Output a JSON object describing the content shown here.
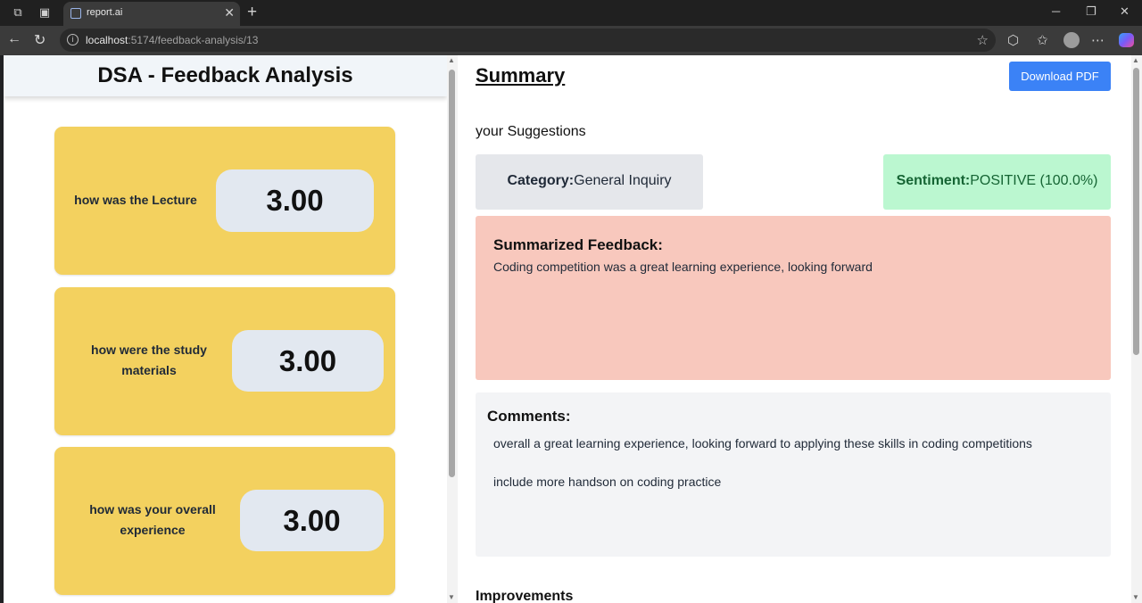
{
  "browser": {
    "tab_title": "report.ai",
    "url_host": "localhost",
    "url_rest": ":5174/feedback-analysis/13"
  },
  "left_panel": {
    "title": "DSA - Feedback Analysis",
    "cards": [
      {
        "question": "how was the Lecture",
        "score": "3.00"
      },
      {
        "question": "how were the study materials",
        "score": "3.00"
      },
      {
        "question": "how was your overall experience",
        "score": "3.00"
      }
    ]
  },
  "summary": {
    "title": "Summary",
    "download_label": "Download PDF",
    "suggestions_label": "your Suggestions",
    "category_label": "Category:",
    "category_value": "General Inquiry",
    "sentiment_label": "Sentiment:",
    "sentiment_value": "POSITIVE (100.0%)",
    "summarized_heading": "Summarized Feedback:",
    "summarized_text": "Coding competition was a great learning experience, looking forward",
    "comments_heading": "Comments:",
    "comments": [
      "overall a great learning experience, looking forward to applying these skills in coding competitions",
      "include more handson on coding practice"
    ],
    "improvements_heading": "Improvements"
  },
  "colors": {
    "card_bg": "#f3d15f",
    "score_bg": "#e2e8f0",
    "button_bg": "#3b82f6",
    "sentiment_bg": "#bbf7d0",
    "summary_bg": "#f8c8bd"
  }
}
